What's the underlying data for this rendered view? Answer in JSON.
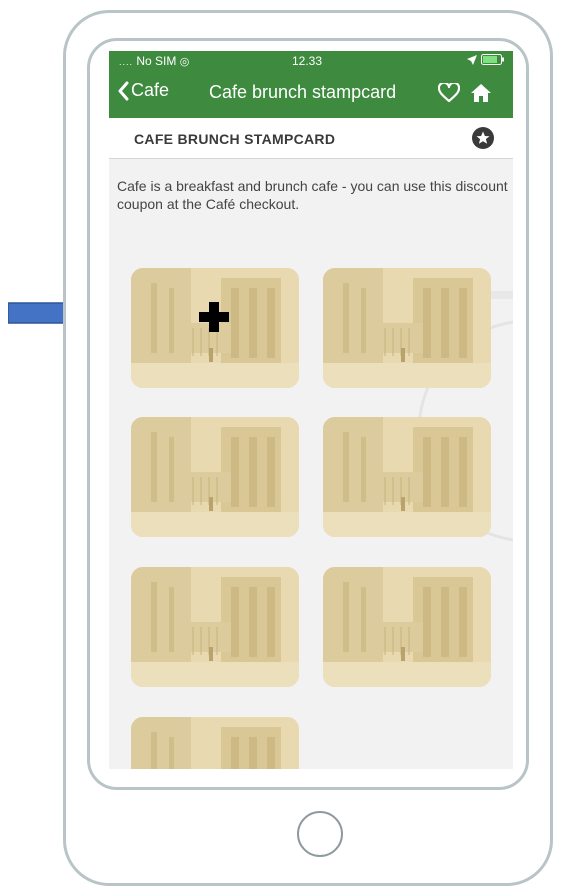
{
  "status": {
    "carrier": "No SIM",
    "time": "12.33"
  },
  "nav": {
    "back_label": "Cafe",
    "title": "Cafe brunch stampcard"
  },
  "card": {
    "header_title": "CAFE BRUNCH STAMPCARD",
    "description": "Cafe is a breakfast and brunch cafe - you can use this discount coupon at the Café checkout."
  },
  "stamps": [
    {
      "state": "add"
    },
    {
      "state": "empty"
    },
    {
      "state": "empty"
    },
    {
      "state": "empty"
    },
    {
      "state": "empty"
    },
    {
      "state": "empty"
    },
    {
      "state": "empty"
    }
  ],
  "colors": {
    "accent": "#3e8a3f",
    "arrow": "#4472c4",
    "stamp": "#e8d9b0"
  },
  "icons": [
    "chevron-left-icon",
    "heart-icon",
    "home-icon",
    "star-icon",
    "plus-icon",
    "location-arrow-icon",
    "battery-icon",
    "wifi-icon"
  ]
}
